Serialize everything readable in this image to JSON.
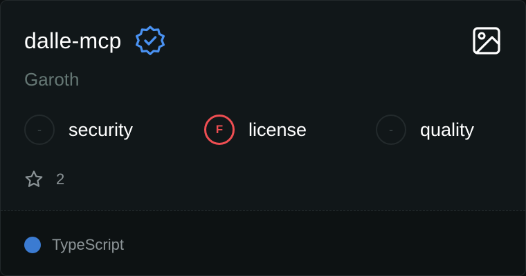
{
  "card": {
    "title": "dalle-mcp",
    "author": "Garoth",
    "verified_icon": "verified-badge-icon",
    "image_icon": "image-icon",
    "accent_color": "#4a92f2"
  },
  "scores": [
    {
      "grade": "-",
      "label": "security",
      "status": "none"
    },
    {
      "grade": "F",
      "label": "license",
      "status": "fail",
      "color": "#ef4e52"
    },
    {
      "grade": "-",
      "label": "quality",
      "status": "none"
    }
  ],
  "stars": {
    "icon": "star-icon",
    "count": "2"
  },
  "footer": {
    "language": "TypeScript",
    "language_color": "#3b7bd1"
  }
}
